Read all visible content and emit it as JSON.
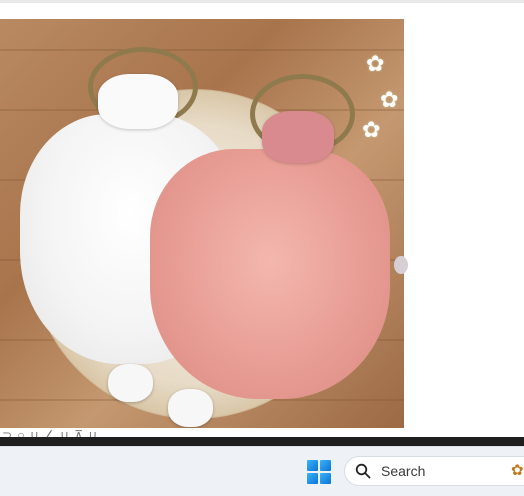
{
  "product_image": {
    "alt": "White and pink tulle baby romper dresses with bow headbands and baby shoes on a woven mat"
  },
  "partial_text": "⊃ ○ ∪ ∠ ∪  ⊼ ∪",
  "taskbar": {
    "start_icon": "windows-logo-icon",
    "search": {
      "placeholder": "Search",
      "icon": "search-icon"
    },
    "tray_icon": "flower-tray-icon"
  },
  "colors": {
    "start_accent": "#0a73d8",
    "taskbar_bg": "#eef2f7"
  }
}
